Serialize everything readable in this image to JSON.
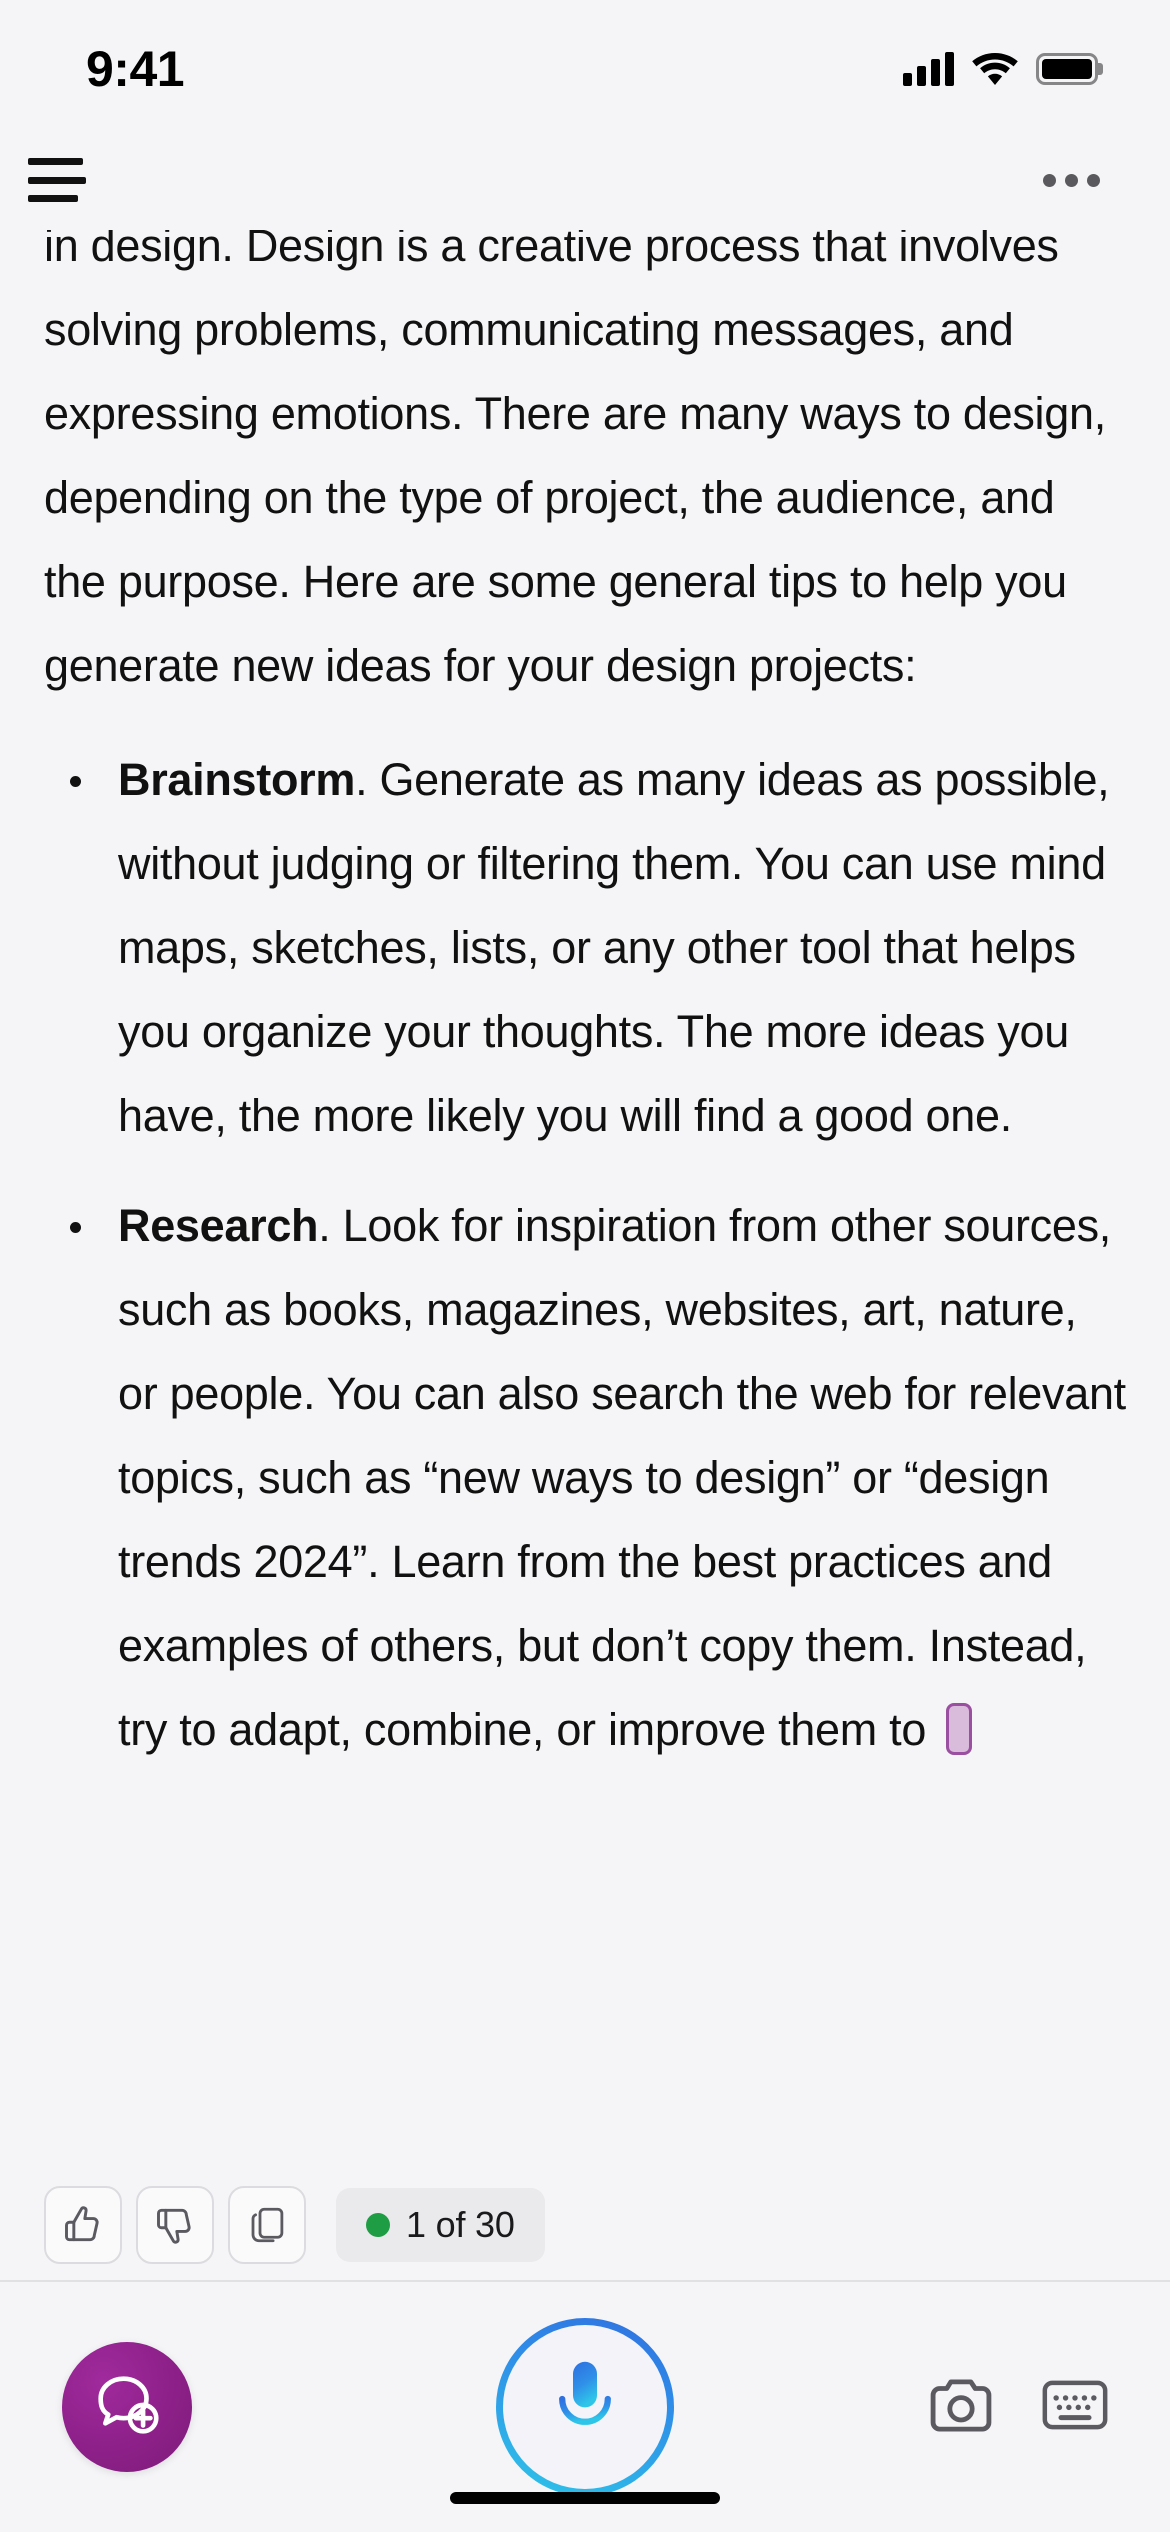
{
  "status_bar": {
    "time": "9:41",
    "signal_icon": "cellular-signal-icon",
    "wifi_icon": "wifi-icon",
    "battery_icon": "battery-full-icon"
  },
  "nav_bar": {
    "menu_icon": "hamburger-menu-icon",
    "overflow_icon": "more-options-icon"
  },
  "message": {
    "paragraph": "in design. Design is a creative process that involves solving problems, communicating messages, and expressing emotions. There are many ways to design, depending on the type of project, the audience, and the purpose. Here are some general tips to help you generate new ideas for your design projects:",
    "bullets": [
      {
        "term": "Brainstorm",
        "text": ". Generate as many ideas as possible, without judging or filtering them. You can use mind maps, sketches, lists, or any other tool that helps you organize your thoughts. The more ideas you have, the more likely you will find a good one."
      },
      {
        "term": "Research",
        "text": ". Look for inspiration from other sources, such as books, magazines, websites, art, nature, or people. You can also search the web for relevant topics, such as “new ways to design” or “design trends 2024”. Learn from the best practices and examples of others, but don’t copy them. Instead, try to adapt, combine, or improve them to "
      }
    ],
    "typing_caret": "streaming-text-caret",
    "caret_color": "#9b4fa0"
  },
  "feedback": {
    "thumbs_up_icon": "thumbs-up-icon",
    "thumbs_down_icon": "thumbs-down-icon",
    "copy_icon": "copy-icon",
    "page_indicator": "1 of 30",
    "status_dot_color": "#1f9d44"
  },
  "toolbar": {
    "new_chat_icon": "new-chat-bubble-plus-icon",
    "new_chat_color": "#8d2089",
    "mic_icon": "microphone-icon",
    "mic_accent_color": "#2f8fe8",
    "camera_icon": "camera-icon",
    "keyboard_icon": "keyboard-icon"
  },
  "home_indicator": "home-indicator"
}
